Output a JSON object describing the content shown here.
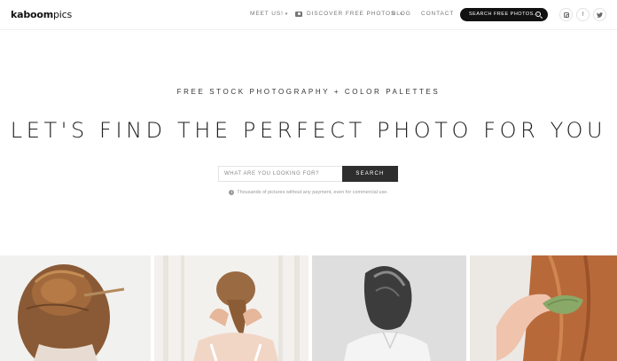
{
  "header": {
    "logo_bold": "kaboom",
    "logo_rest": "pics",
    "nav": {
      "meet_us": "MEET US!",
      "discover": "DISCOVER FREE PHOTOS",
      "blog": "BLOG",
      "contact": "CONTACT"
    },
    "search_pill_label": "SEARCH FREE PHOTOS...",
    "social": {
      "facebook": "f",
      "twitter": "⚑"
    }
  },
  "hero": {
    "tagline": "FREE STOCK PHOTOGRAPHY + COLOR PALETTES",
    "headline": "LET'S FIND THE PERFECT PHOTO FOR YOU",
    "search_placeholder": "WHAT ARE YOU LOOKING FOR?",
    "search_button": "SEARCH",
    "note_icon": "i",
    "note": "Thousands of pictures without any payment, even for commercial use."
  },
  "photos": [
    {
      "subject": "woman-hair-bun-with-stick"
    },
    {
      "subject": "woman-braiding-hair-back-view"
    },
    {
      "subject": "woman-hair-covering-face-bw"
    },
    {
      "subject": "hand-holding-green-comb-red-hair"
    }
  ],
  "colors": {
    "accent_dark": "#111111",
    "search_button_bg": "#2e2e2e",
    "nav_text": "#777777"
  }
}
